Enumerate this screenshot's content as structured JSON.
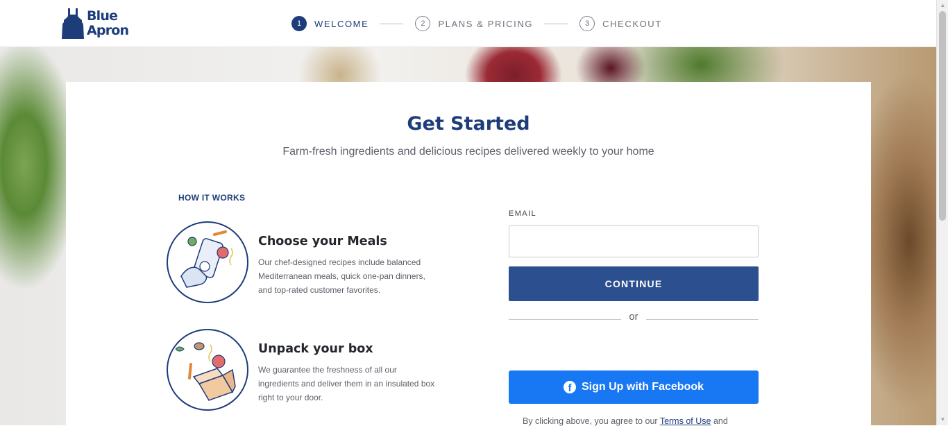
{
  "brand": {
    "logo_line1": "Blue",
    "logo_line2": "Apron",
    "color": "#1d3c7a"
  },
  "steps": [
    {
      "num": "1",
      "label": "WELCOME",
      "active": true
    },
    {
      "num": "2",
      "label": "PLANS & PRICING",
      "active": false
    },
    {
      "num": "3",
      "label": "CHECKOUT",
      "active": false
    }
  ],
  "card": {
    "title": "Get Started",
    "subtitle": "Farm-fresh ingredients and delicious recipes delivered weekly to your home",
    "how_it_works": "HOW IT WORKS",
    "features": [
      {
        "title": "Choose your Meals",
        "description": "Our chef-designed recipes include balanced Mediterranean meals, quick one-pan dinners, and top-rated customer favorites.",
        "icon": "phone-meal-illustration"
      },
      {
        "title": "Unpack your box",
        "description": "We guarantee the freshness of all our ingredients and deliver them in an insulated box right to your door.",
        "icon": "box-unpacking-illustration"
      }
    ]
  },
  "form": {
    "email_label": "EMAIL",
    "email_value": "",
    "email_placeholder": "",
    "continue_label": "CONTINUE",
    "or_text": "or",
    "facebook_label": "Sign Up with Facebook",
    "facebook_icon": "f",
    "facebook_color": "#1877f2",
    "terms_prefix": "By clicking above, you agree to our",
    "terms_link": "Terms of Use",
    "terms_suffix": "and"
  }
}
